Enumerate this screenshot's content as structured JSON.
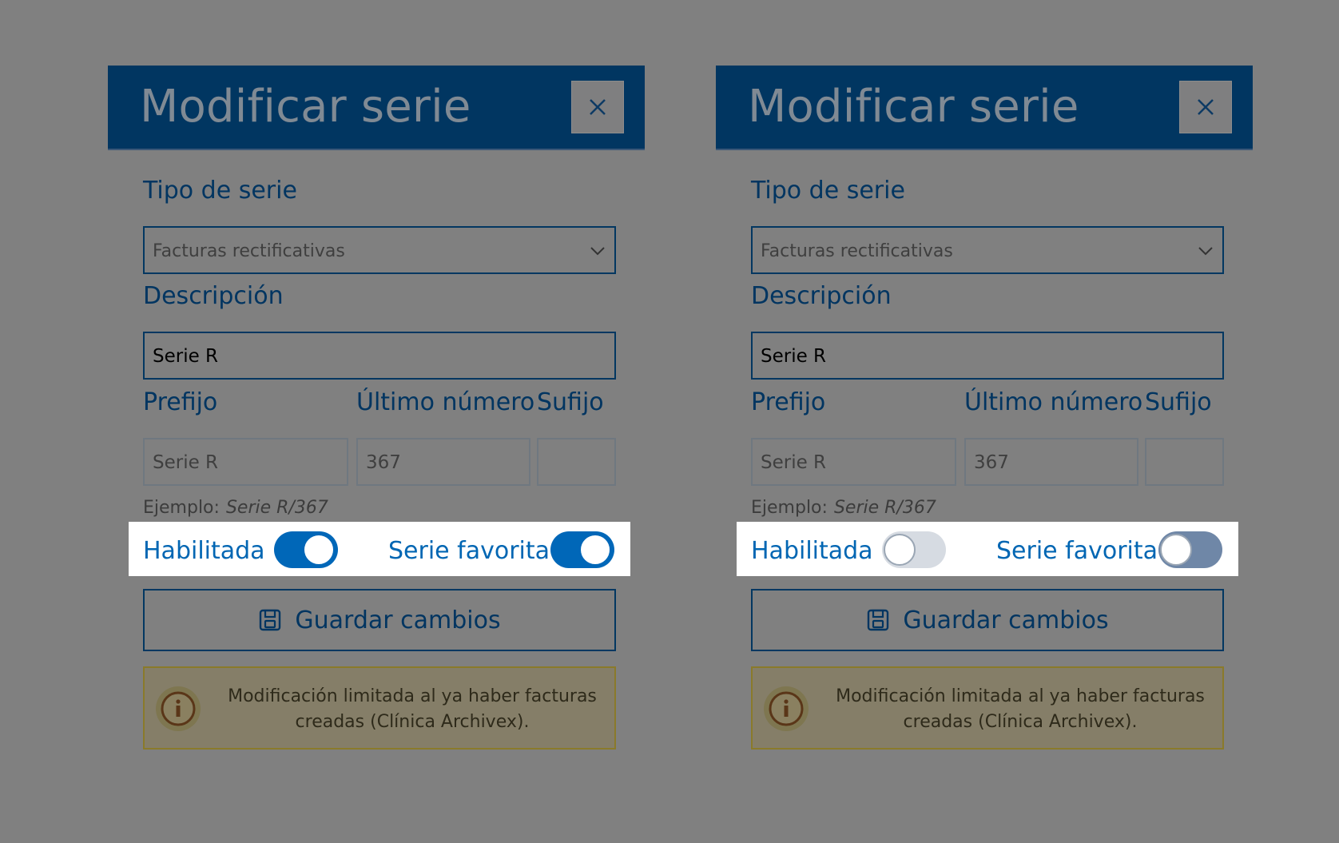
{
  "panels": [
    {
      "title": "Modificar serie",
      "tipo_label": "Tipo de serie",
      "tipo_value": "Facturas rectificativas",
      "descripcion_label": "Descripción",
      "descripcion_value": "Serie R",
      "prefijo_label": "Prefijo",
      "ultimo_label": "Último número",
      "sufijo_label": "Sufijo",
      "prefijo_value": "Serie R",
      "ultimo_value": "367",
      "sufijo_value": "",
      "ejemplo_label": "Ejemplo:",
      "ejemplo_value": "Serie R/367",
      "habilitada_label": "Habilitada",
      "habilitada_on": true,
      "favorita_label": "Serie favorita",
      "favorita_on": true,
      "save_label": "Guardar cambios",
      "notice_text": "Modificación limitada al ya haber facturas creadas (Clínica Archivex)."
    },
    {
      "title": "Modificar serie",
      "tipo_label": "Tipo de serie",
      "tipo_value": "Facturas rectificativas",
      "descripcion_label": "Descripción",
      "descripcion_value": "Serie R",
      "prefijo_label": "Prefijo",
      "ultimo_label": "Último número",
      "sufijo_label": "Sufijo",
      "prefijo_value": "Serie R",
      "ultimo_value": "367",
      "sufijo_value": "",
      "ejemplo_label": "Ejemplo:",
      "ejemplo_value": "Serie R/367",
      "habilitada_label": "Habilitada",
      "habilitada_on": false,
      "favorita_label": "Serie favorita",
      "favorita_on": false,
      "save_label": "Guardar cambios",
      "notice_text": "Modificación limitada al ya haber facturas creadas (Clínica Archivex)."
    }
  ],
  "icons": {
    "close": "close-icon",
    "chevron": "chevron-down-icon",
    "save": "floppy-disk-icon",
    "info": "info-icon"
  },
  "colors": {
    "header_bg": "#013661",
    "accent": "#0067b8",
    "overlay": "#808080",
    "highlight": "#ffffff"
  }
}
